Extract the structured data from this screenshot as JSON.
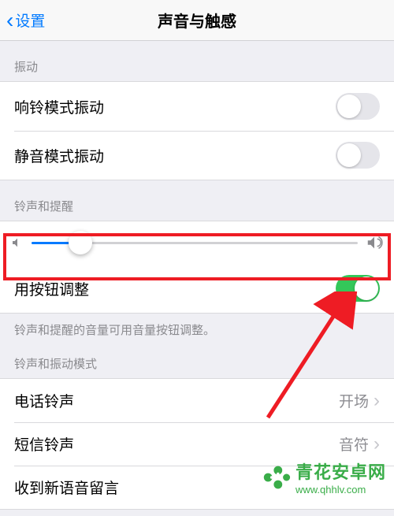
{
  "header": {
    "back_label": "设置",
    "title": "声音与触感"
  },
  "sections": {
    "vibration": {
      "header": "振动",
      "ring_mode_vibrate": {
        "label": "响铃模式振动",
        "on": false
      },
      "silent_mode_vibrate": {
        "label": "静音模式振动",
        "on": false
      }
    },
    "ringer": {
      "header": "铃声和提醒",
      "slider_value_pct": 15,
      "change_with_buttons": {
        "label": "用按钮调整",
        "on": true
      },
      "footer": "铃声和提醒的音量可用音量按钮调整。"
    },
    "sounds": {
      "header": "铃声和振动模式",
      "ringtone": {
        "label": "电话铃声",
        "value": "开场"
      },
      "text_tone": {
        "label": "短信铃声",
        "value": "音符"
      },
      "voicemail": {
        "label": "收到新语音留言"
      }
    }
  },
  "watermark": {
    "brand": "青花安卓网",
    "url": "www.qhhlv.com"
  },
  "annotation": {
    "highlight_color": "#ee1c24",
    "arrow_color": "#ee1c24"
  }
}
